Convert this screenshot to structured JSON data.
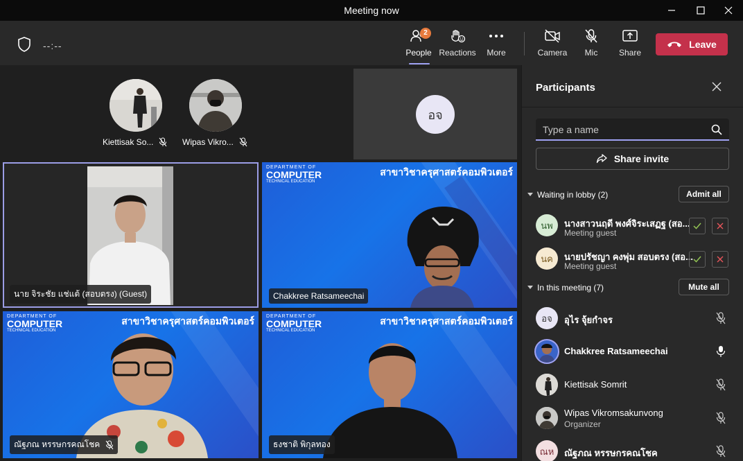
{
  "window": {
    "title": "Meeting now"
  },
  "toolbar": {
    "timer": "--:--",
    "people_label": "People",
    "people_badge": "2",
    "reactions_label": "Reactions",
    "more_label": "More",
    "camera_label": "Camera",
    "mic_label": "Mic",
    "share_label": "Share",
    "leave_label": "Leave"
  },
  "stage": {
    "top_avatars": [
      {
        "name": "Kiettisak So..."
      },
      {
        "name": "Wipas Vikro..."
      }
    ],
    "initials_tile": "อจ",
    "tiles": [
      {
        "name": "นาย จิระชัย แช่แต้ (สอบตรง) (Guest)"
      },
      {
        "name": "Chakkree Ratsameechai"
      },
      {
        "name": "ณัฐภณ หรรษกรคณโชค"
      },
      {
        "name": "ธงชาติ พิกุลทอง"
      }
    ],
    "slide": {
      "dept_line1": "DEPARTMENT OF",
      "dept_line2": "COMPUTER",
      "dept_line3": "TECHNICAL EDUCATION",
      "thai_heading": "สาขาวิชาครุศาสตร์คอมพิวเตอร์"
    }
  },
  "panel": {
    "title": "Participants",
    "search_placeholder": "Type a name",
    "share_invite_label": "Share invite",
    "lobby_header": "Waiting in lobby (2)",
    "admit_all_label": "Admit all",
    "lobby": [
      {
        "initials": "นพ",
        "name": "นางสาวนฤดี พงศ์จิระเสฏฐ (สอ...",
        "sub": "Meeting guest"
      },
      {
        "initials": "นค",
        "name": "นายปรัชญา คงพุ่ม สอบตรง (สอ...",
        "sub": "Meeting guest"
      }
    ],
    "meeting_header": "In this meeting (7)",
    "mute_all_label": "Mute all",
    "members": [
      {
        "initials": "อจ",
        "name": "อุไร จุ้ยกำจร",
        "sub": ""
      },
      {
        "initials": "",
        "name": "Chakkree Ratsameechai",
        "sub": ""
      },
      {
        "initials": "",
        "name": "Kiettisak Somrit",
        "sub": ""
      },
      {
        "initials": "",
        "name": "Wipas Vikromsakunvong",
        "sub": "Organizer"
      },
      {
        "initials": "ณห",
        "name": "ณัฐภณ หรรษกรคณโชค",
        "sub": ""
      }
    ]
  },
  "colors": {
    "accent": "#9fa2f3",
    "leave": "#c4314b",
    "badge": "#e67a3d"
  }
}
